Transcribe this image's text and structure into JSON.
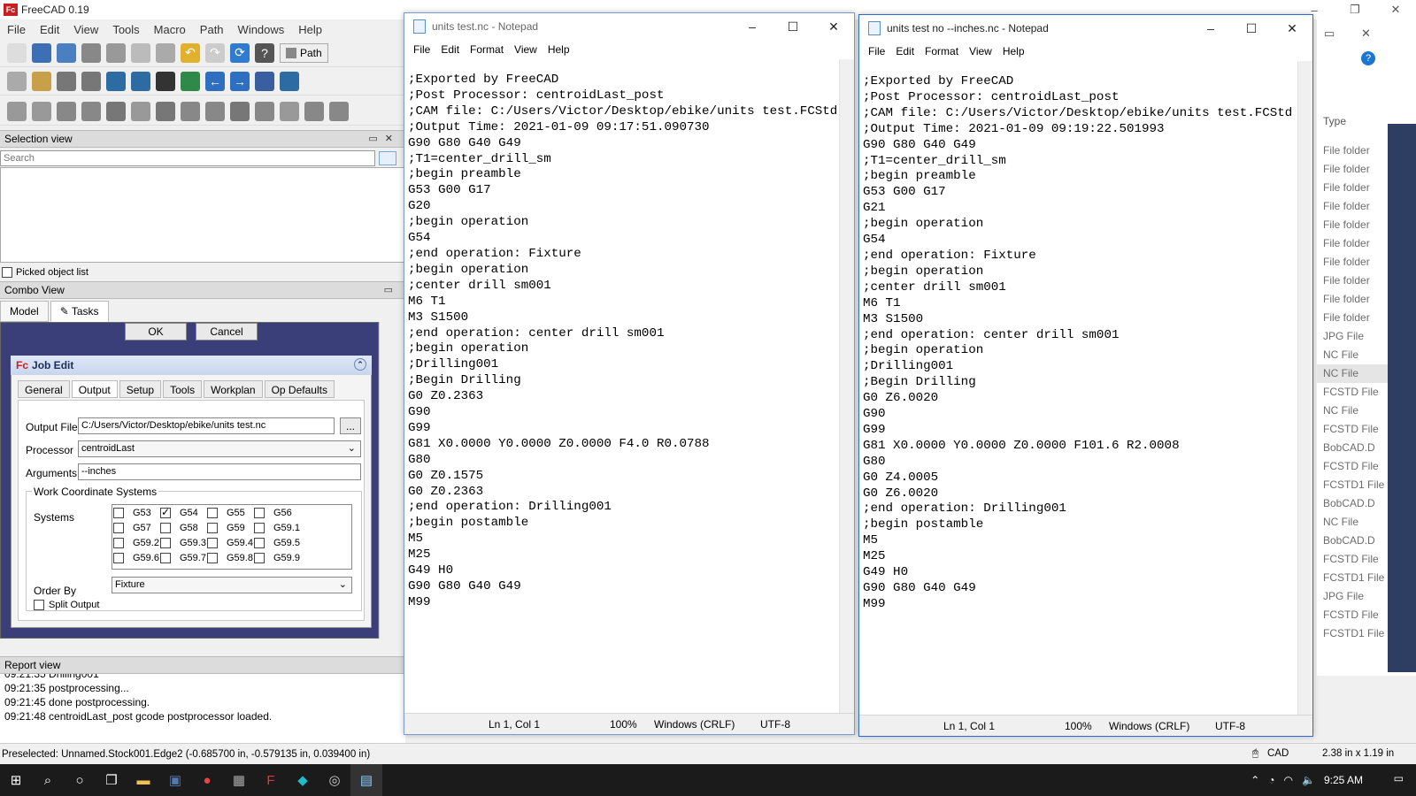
{
  "freecad": {
    "title": "FreeCAD 0.19",
    "menu": [
      "File",
      "Edit",
      "View",
      "Tools",
      "Macro",
      "Path",
      "Windows",
      "Help"
    ],
    "path_button": "Path",
    "selection_view": {
      "title": "Selection view",
      "search_placeholder": "Search",
      "picked_list": "Picked object list"
    },
    "combo_view": {
      "title": "Combo View",
      "tabs": [
        "Model",
        "Tasks"
      ],
      "ok": "OK",
      "cancel": "Cancel"
    },
    "job_edit": {
      "title": "Job Edit",
      "tabs": [
        "General",
        "Output",
        "Setup",
        "Tools",
        "Workplan",
        "Op Defaults"
      ],
      "output_file_label": "Output File",
      "output_file": "C:/Users/Victor/Desktop/ebike/units test.nc",
      "browse": "...",
      "processor_label": "Processor",
      "processor": "centroidLast",
      "arguments_label": "Arguments",
      "arguments": "--inches",
      "wcs_title": "Work Coordinate Systems",
      "systems_label": "Systems",
      "systems": [
        "G53",
        "G54",
        "G55",
        "G56",
        "G57",
        "G58",
        "G59",
        "G59.1",
        "G59.2",
        "G59.3",
        "G59.4",
        "G59.5",
        "G59.6",
        "G59.7",
        "G59.8",
        "G59.9"
      ],
      "order_by_label": "Order By",
      "order_by": "Fixture",
      "split_output": "Split Output"
    },
    "report_view": {
      "title": "Report view",
      "lines": [
        "09:21:35  Drilling001",
        "09:21:35  postprocessing...",
        "09:21:45  done postprocessing.",
        "09:21:48  centroidLast_post gcode postprocessor loaded."
      ]
    },
    "status": "Preselected: Unnamed.Stock001.Edge2 (-0.685700 in, -0.579135 in, 0.039400 in)",
    "status_right": {
      "units": "CAD",
      "dims": "2.38 in x 1.19 in"
    }
  },
  "notepad1": {
    "title": "units test.nc - Notepad",
    "menu": [
      "File",
      "Edit",
      "Format",
      "View",
      "Help"
    ],
    "content": ";Exported by FreeCAD\n;Post Processor: centroidLast_post\n;CAM file: C:/Users/Victor/Desktop/ebike/units test.FCStd\n;Output Time: 2021-01-09 09:17:51.090730\nG90 G80 G40 G49\n;T1=center_drill_sm\n;begin preamble\nG53 G00 G17\nG20\n;begin operation\nG54\n;end operation: Fixture\n;begin operation\n;center drill sm001\nM6 T1\nM3 S1500\n;end operation: center drill sm001\n;begin operation\n;Drilling001\n;Begin Drilling\nG0 Z0.2363\nG90\nG99\nG81 X0.0000 Y0.0000 Z0.0000 F4.0 R0.0788\nG80\nG0 Z0.1575\nG0 Z0.2363\n;end operation: Drilling001\n;begin postamble\nM5\nM25\nG49 H0\nG90 G80 G40 G49\nM99",
    "status": {
      "pos": "Ln 1, Col 1",
      "zoom": "100%",
      "eol": "Windows (CRLF)",
      "enc": "UTF-8"
    }
  },
  "notepad2": {
    "title": "units test no --inches.nc - Notepad",
    "menu": [
      "File",
      "Edit",
      "Format",
      "View",
      "Help"
    ],
    "content": ";Exported by FreeCAD\n;Post Processor: centroidLast_post\n;CAM file: C:/Users/Victor/Desktop/ebike/units test.FCStd\n;Output Time: 2021-01-09 09:19:22.501993\nG90 G80 G40 G49\n;T1=center_drill_sm\n;begin preamble\nG53 G00 G17\nG21\n;begin operation\nG54\n;end operation: Fixture\n;begin operation\n;center drill sm001\nM6 T1\nM3 S1500\n;end operation: center drill sm001\n;begin operation\n;Drilling001\n;Begin Drilling\nG0 Z6.0020\nG90\nG99\nG81 X0.0000 Y0.0000 Z0.0000 F101.6 R2.0008\nG80\nG0 Z4.0005\nG0 Z6.0020\n;end operation: Drilling001\n;begin postamble\nM5\nM25\nG49 H0\nG90 G80 G40 G49\nM99",
    "status": {
      "pos": "Ln 1, Col 1",
      "zoom": "100%",
      "eol": "Windows (CRLF)",
      "enc": "UTF-8"
    }
  },
  "explorer": {
    "type_header": "Type",
    "rows": [
      "File folder",
      "File folder",
      "File folder",
      "File folder",
      "File folder",
      "File folder",
      "File folder",
      "File folder",
      "File folder",
      "File folder",
      "JPG File",
      "NC File",
      "NC File",
      "FCSTD File",
      "NC File",
      "FCSTD File",
      "BobCAD.D",
      "FCSTD File",
      "FCSTD1 File",
      "BobCAD.D",
      "NC File",
      "BobCAD.D",
      "FCSTD File",
      "FCSTD1 File",
      "JPG File",
      "FCSTD File",
      "FCSTD1 File"
    ],
    "selected_index": 12
  },
  "taskbar": {
    "time": "9:25 AM"
  }
}
